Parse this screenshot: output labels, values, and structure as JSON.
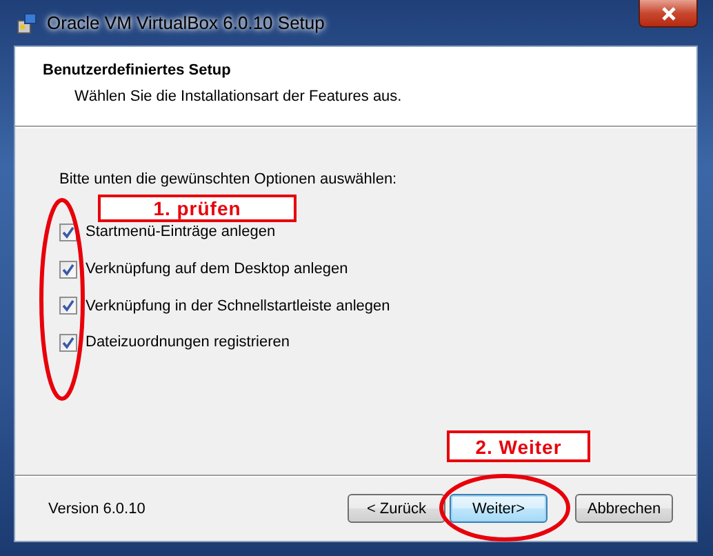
{
  "window": {
    "title": "Oracle VM VirtualBox 6.0.10 Setup"
  },
  "header": {
    "title": "Benutzerdefiniertes Setup",
    "subtitle": "Wählen Sie die Installationsart der Features aus."
  },
  "prompt": "Bitte unten die gewünschten Optionen auswählen:",
  "options": [
    {
      "label": "Startmenü-Einträge anlegen",
      "checked": true
    },
    {
      "label": "Verknüpfung auf dem Desktop anlegen",
      "checked": true
    },
    {
      "label": "Verknüpfung in der Schnellstartleiste anlegen",
      "checked": true
    },
    {
      "label": "Dateizuordnungen registrieren",
      "checked": true
    }
  ],
  "annotations": [
    {
      "kind": "step",
      "text": "1. prüfen"
    },
    {
      "kind": "step",
      "text": "2. Weiter"
    }
  ],
  "version": "Version 6.0.10",
  "buttons": [
    {
      "label": "< Zurück",
      "default": false
    },
    {
      "label": "Weiter>",
      "default": true
    },
    {
      "label": "Abbrechen",
      "default": false
    }
  ]
}
